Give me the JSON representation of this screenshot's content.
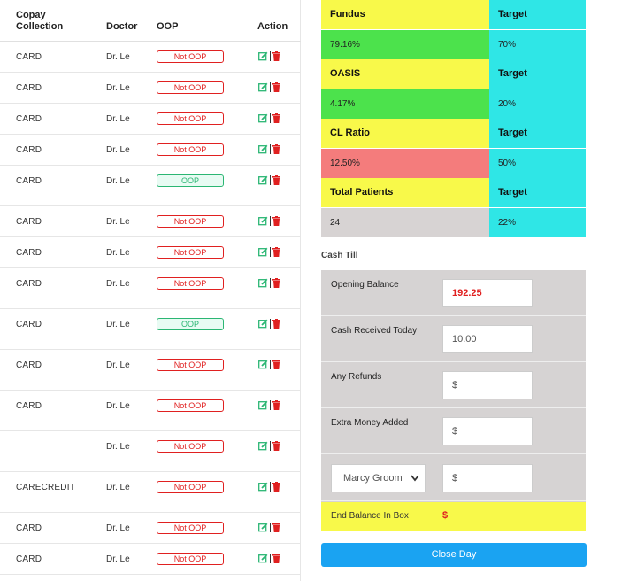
{
  "table": {
    "headers": {
      "copay_line1": "Copay",
      "copay_line2": "Collection",
      "doctor": "Doctor",
      "oop": "OOP",
      "action": "Action"
    },
    "rows": [
      {
        "copay": "CARD",
        "doctor": "Dr. Le",
        "oop": "Not OOP"
      },
      {
        "copay": "CARD",
        "doctor": "Dr. Le",
        "oop": "Not OOP"
      },
      {
        "copay": "CARD",
        "doctor": "Dr. Le",
        "oop": "Not OOP"
      },
      {
        "copay": "CARD",
        "doctor": "Dr. Le",
        "oop": "Not OOP"
      },
      {
        "copay": "CARD",
        "doctor": "Dr. Le",
        "oop": "OOP"
      },
      {
        "copay": "CARD",
        "doctor": "Dr. Le",
        "oop": "Not OOP"
      },
      {
        "copay": "CARD",
        "doctor": "Dr. Le",
        "oop": "Not OOP"
      },
      {
        "copay": "CARD",
        "doctor": "Dr. Le",
        "oop": "Not OOP"
      },
      {
        "copay": "CARD",
        "doctor": "Dr. Le",
        "oop": "OOP"
      },
      {
        "copay": "CARD",
        "doctor": "Dr. Le",
        "oop": "Not OOP"
      },
      {
        "copay": "CARD",
        "doctor": "Dr. Le",
        "oop": "Not OOP"
      },
      {
        "copay": "",
        "doctor": "Dr. Le",
        "oop": "Not OOP"
      },
      {
        "copay": "CARECREDIT",
        "doctor": "Dr. Le",
        "oop": "Not OOP"
      },
      {
        "copay": "CARD",
        "doctor": "Dr. Le",
        "oop": "Not OOP"
      },
      {
        "copay": "CARD",
        "doctor": "Dr. Le",
        "oop": "Not OOP"
      }
    ]
  },
  "metrics": {
    "fundus": {
      "label": "Fundus",
      "target_label": "Target",
      "value": "79.16%",
      "target": "70%"
    },
    "oasis": {
      "label": "OASIS",
      "target_label": "Target",
      "value": "4.17%",
      "target": "20%"
    },
    "cl_ratio": {
      "label": "CL Ratio",
      "target_label": "Target",
      "value": "12.50%",
      "target": "50%"
    },
    "total_patients": {
      "label": "Total Patients",
      "target_label": "Target",
      "value": "24",
      "target": "22%"
    }
  },
  "cash_till": {
    "title": "Cash Till",
    "opening_balance_label": "Opening Balance",
    "opening_balance_value": "192.25",
    "cash_received_label": "Cash Received Today",
    "cash_received_value": "10.00",
    "refunds_label": "Any Refunds",
    "refunds_placeholder": "$",
    "extra_money_label": "Extra Money Added",
    "extra_money_placeholder": "$",
    "staff_select_value": "Marcy Groom",
    "staff_amount_placeholder": "$",
    "end_balance_label": "End Balance In Box",
    "end_balance_value": "$"
  },
  "actions": {
    "close_day_label": "Close Day"
  },
  "colors": {
    "yellow": "#f8f94a",
    "cyan": "#2fe6e6",
    "green": "#4ce24c",
    "red": "#f47c7c",
    "gray": "#d7d3d3",
    "accent_blue": "#1aa3f2",
    "danger": "#e02020",
    "success": "#2bb673"
  }
}
